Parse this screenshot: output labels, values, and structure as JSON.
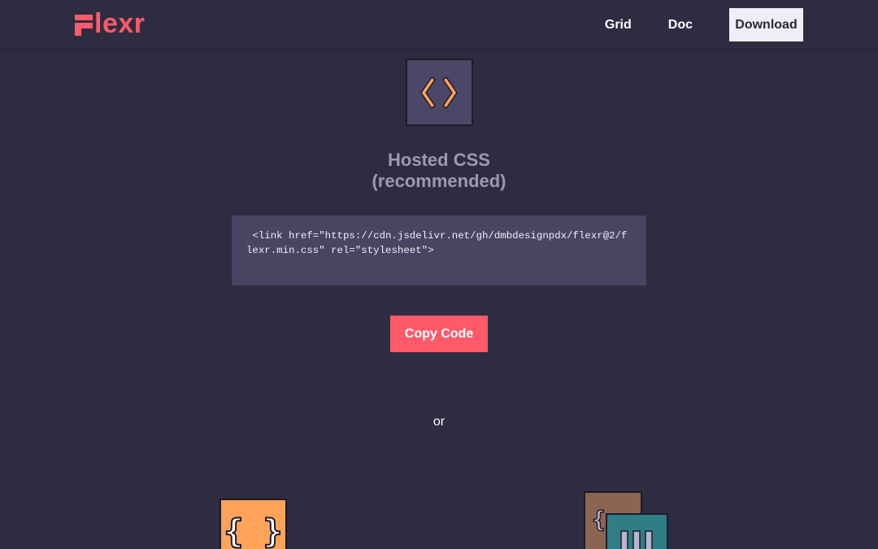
{
  "header": {
    "logo_text": "lexr",
    "nav": {
      "grid_label": "Grid",
      "doc_label": "Doc",
      "download_label": "Download"
    }
  },
  "main": {
    "icon": "code-brackets-icon",
    "title_line1": "Hosted CSS",
    "title_line2": "(recommended)",
    "code_snippet": " <link href=\"https://cdn.jsdelivr.net/gh/dmbdesignpdx/flexr@2/flexr.min.css\" rel=\"stylesheet\">",
    "copy_button_label": "Copy Code",
    "separator_text": "or"
  },
  "bottom_cards": [
    {
      "icon": "curly-braces-icon",
      "color": "#ffa35a"
    },
    {
      "icon": "columns-stack-icon",
      "back_color": "#8b6552",
      "front_color": "#2f7e86"
    }
  ],
  "colors": {
    "background": "#2e2c40",
    "brand": "#ff5a6a",
    "tile": "#4a4866",
    "code_bg": "#474562",
    "accent_orange": "#ffa35a"
  }
}
